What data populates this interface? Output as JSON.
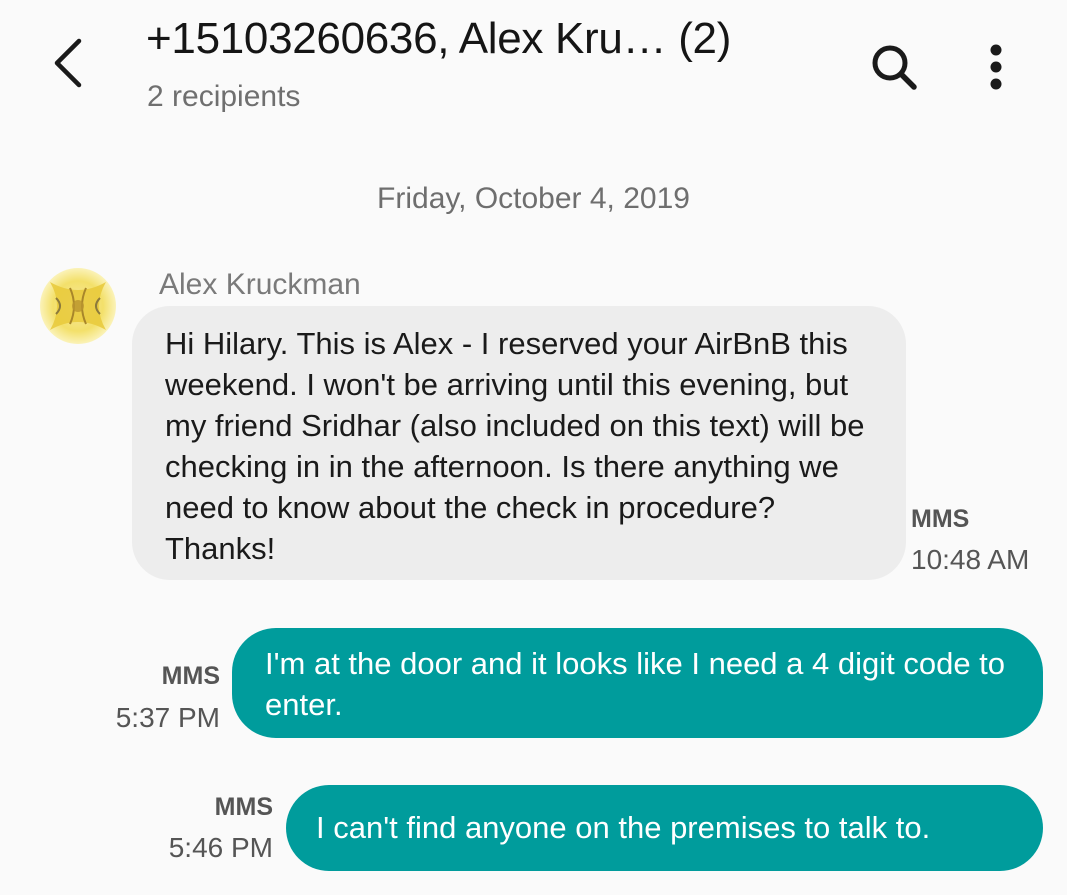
{
  "header": {
    "title": "+15103260636, Alex Kru… (2)",
    "subtitle": "2 recipients",
    "back_icon": "chevron-left-icon",
    "search_icon": "search-icon",
    "more_icon": "more-vert-icon"
  },
  "conversation": {
    "date": "Friday, October 4, 2019",
    "messages": [
      {
        "direction": "incoming",
        "sender": "Alex Kruckman",
        "text": "Hi Hilary. This is Alex - I reserved your AirBnB this weekend. I won't be arriving until this evening, but my friend Sridhar (also included on this text) will be checking in in the afternoon. Is there anything we need to know about the check in procedure? Thanks!",
        "type": "MMS",
        "time": "10:48 AM"
      },
      {
        "direction": "outgoing",
        "text": "I'm at the door and it looks like I need a 4 digit code to enter.",
        "type": "MMS",
        "time": "5:37 PM"
      },
      {
        "direction": "outgoing",
        "text": "I can't find anyone on the premises to talk to.",
        "type": "MMS",
        "time": "5:46 PM"
      }
    ]
  },
  "colors": {
    "background": "#fafafa",
    "incoming_bubble": "#ededed",
    "outgoing_bubble": "#009c9c",
    "outgoing_text": "#ffffff"
  }
}
